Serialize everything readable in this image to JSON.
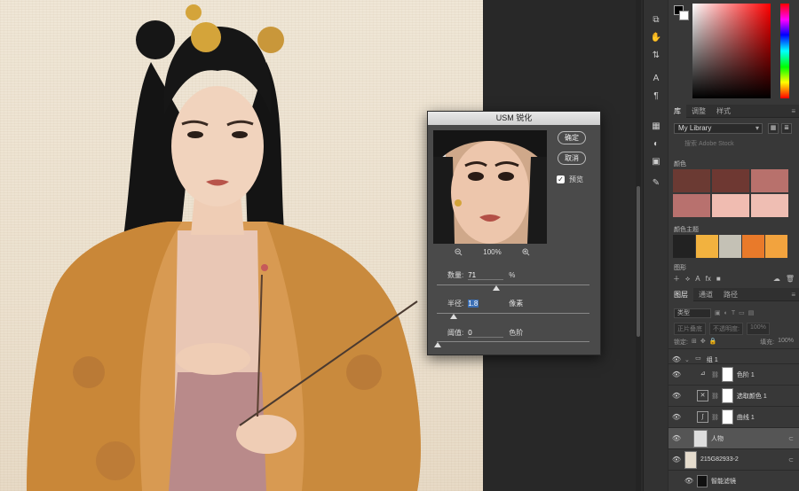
{
  "usm_dialog": {
    "title": "USM 锐化",
    "ok_label": "确定",
    "cancel_label": "取消",
    "preview_label": "预览",
    "preview_checked": true,
    "zoom": "100%",
    "amount": {
      "label": "数量:",
      "value": "71",
      "unit": "%"
    },
    "radius": {
      "label": "半径:",
      "value": "1.8",
      "unit": "像素"
    },
    "threshold": {
      "label": "阈值:",
      "value": "0",
      "unit": "色阶"
    }
  },
  "tools": [
    "text-icon",
    "paragraph-icon",
    "swatches-icon",
    "brush-icon",
    "clone-icon",
    "character-icon",
    "paragraph-style-icon",
    "adjustment-icon",
    "layers-icon"
  ],
  "library_panel": {
    "tabs": [
      "库",
      "调整",
      "样式"
    ],
    "library_name": "My Library",
    "search_placeholder": "搜索 Adobe Stock",
    "colors_label": "颜色",
    "colors": [
      "#6b3a33",
      "#6e3832",
      "#b8716c",
      "#b8716e",
      "#f0bcb1",
      "#efbeb3"
    ],
    "theme_label": "颜色主题",
    "theme_colors": [
      "#222222",
      "#f2b23f",
      "#c4c1b5",
      "#e97a2a",
      "#f2a33e"
    ],
    "graphics_label": "图形"
  },
  "layers_panel": {
    "tabs": [
      "图层",
      "通道",
      "路径"
    ],
    "filter_kind": "类型",
    "blend_mode": "正片叠底",
    "opacity_label": "不透明度:",
    "opacity_value": "100%",
    "lock_label": "锁定:",
    "fill_label": "填充:",
    "fill_value": "100%",
    "layers": [
      {
        "name": "组 1",
        "type": "group"
      },
      {
        "name": "色阶 1",
        "type": "adjustment"
      },
      {
        "name": "选取颜色 1",
        "type": "adjustment"
      },
      {
        "name": "曲线 1",
        "type": "adjustment"
      },
      {
        "name": "人物",
        "type": "pixel",
        "selected": true
      },
      {
        "name": "215G82933-2",
        "type": "pixel"
      },
      {
        "name": "智能滤镜",
        "type": "filter"
      }
    ]
  }
}
